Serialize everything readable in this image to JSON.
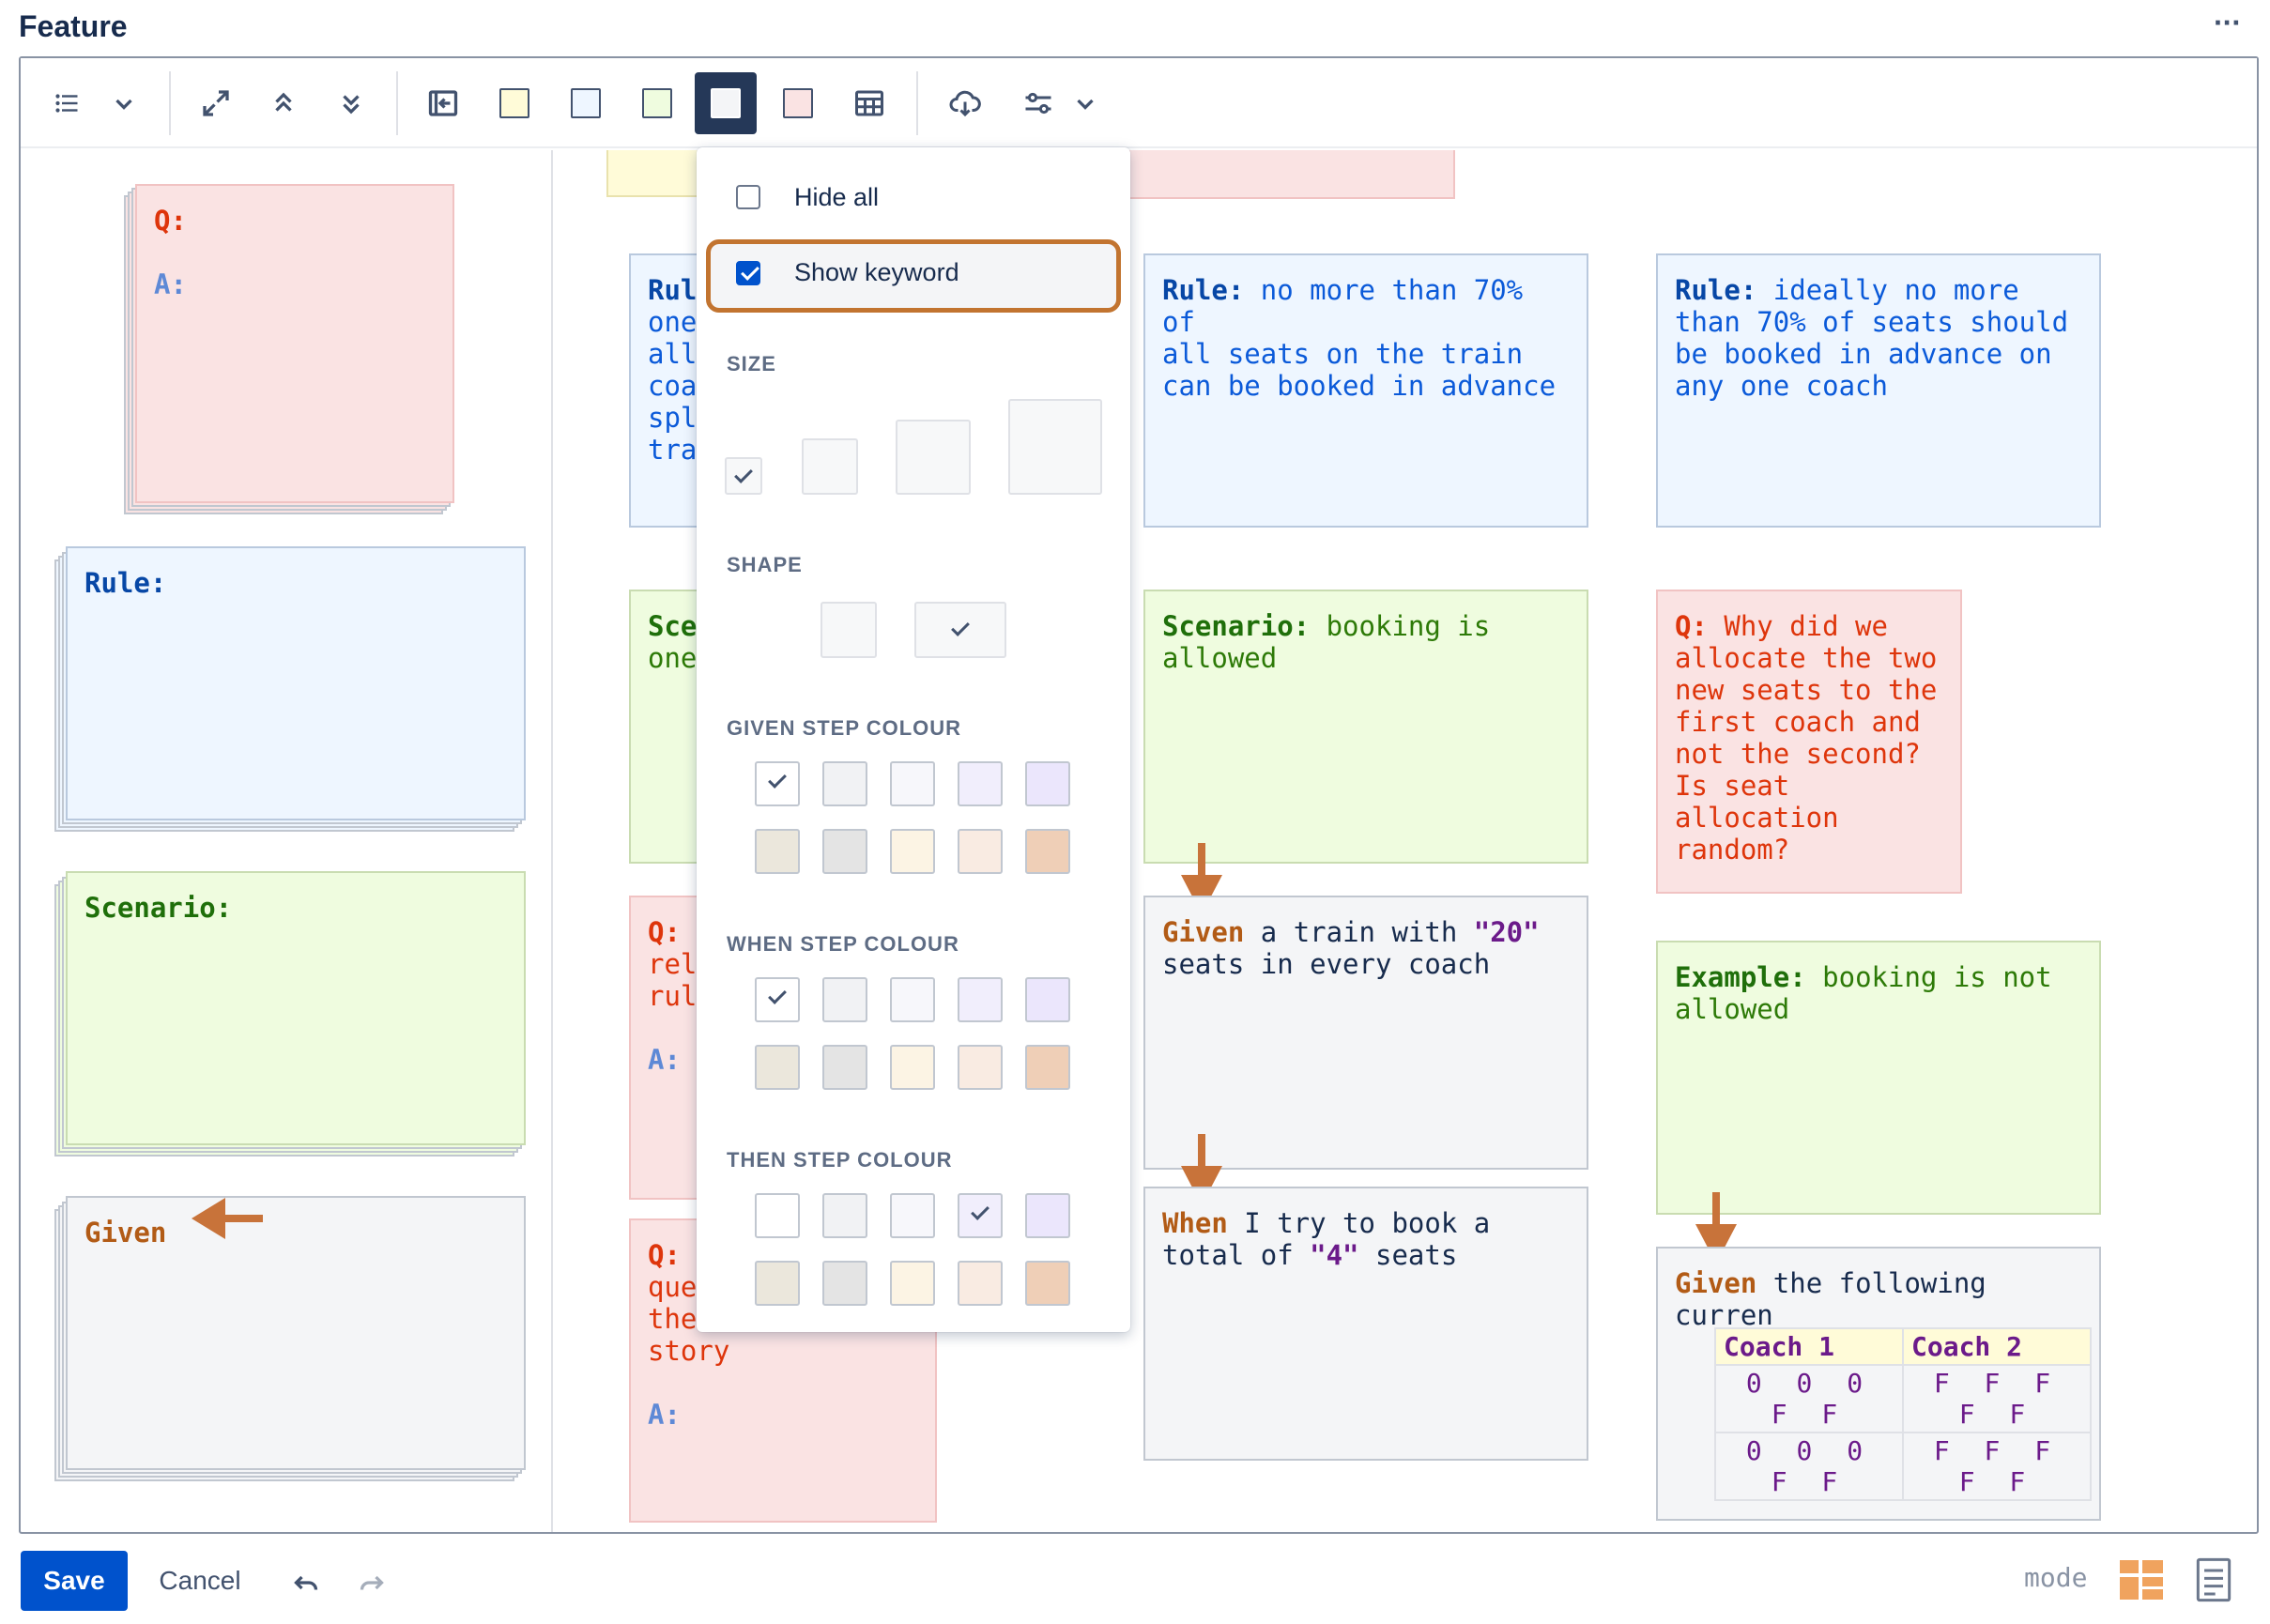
{
  "header": {
    "title": "Feature",
    "more_label": "···"
  },
  "toolbar": {
    "icons": [
      "list-icon",
      "chevron-down-icon",
      "expand-icon",
      "collapse-up-icon",
      "collapse-down-icon",
      "back-arrow-icon",
      "yellow-card-icon",
      "blue-card-icon",
      "green-card-icon",
      "grey-card-icon",
      "pink-card-icon",
      "table-icon",
      "cloud-download-icon",
      "settings-sliders-icon",
      "chevron-down-icon"
    ],
    "swatches": {
      "yellow": "#fffbd8",
      "blue": "#eef6ff",
      "green": "#effcdf",
      "grey": "#f4f5f7",
      "pink": "#fae3e3",
      "active_bg": "#253858"
    }
  },
  "dropdown": {
    "hide_all_label": "Hide all",
    "hide_all_checked": false,
    "show_keyword_label": "Show keyword",
    "show_keyword_checked": true,
    "size_heading": "SIZE",
    "shape_heading": "SHAPE",
    "given_heading": "GIVEN STEP COLOUR",
    "when_heading": "WHEN STEP COLOUR",
    "then_heading": "THEN STEP COLOUR",
    "colour_rows": [
      [
        "#ffffff",
        "#f1f2f4",
        "#f7f7fb",
        "#f1eefc",
        "#ebe6fc"
      ],
      [
        "#ebe7dc",
        "#e4e4e4",
        "#fcf4e4",
        "#f9ebe2",
        "#efcfb7"
      ]
    ]
  },
  "left_column": {
    "qa_card": {
      "q": "Q:",
      "a": "A:"
    },
    "rule_card": {
      "keyword": "Rule:"
    },
    "scenario_card": {
      "keyword": "Scenario:"
    },
    "given_card": {
      "keyword": "Given"
    }
  },
  "board": {
    "rule_partial": {
      "lines": [
        "Rul",
        "one",
        "all",
        "coa",
        "spl",
        "tra"
      ]
    },
    "scenario_partial": {
      "lines": [
        "Sce",
        "one"
      ]
    },
    "q_partial_1": {
      "q": "Q:",
      "lines": [
        "rel",
        "rul"
      ],
      "a": "A:"
    },
    "q_partial_2": {
      "q": "Q:",
      "lines": [
        "que",
        "the",
        "story"
      ],
      "a": "A:"
    },
    "rule_1": {
      "keyword": "Rule:",
      "text": " no more than 70% of\nall seats on the train\ncan be booked in advance"
    },
    "rule_2": {
      "keyword": "Rule:",
      "text": " ideally no more\nthan 70% of seats should\nbe booked in advance on\nany one coach"
    },
    "scenario_1": {
      "keyword": "Scenario:",
      "text": " booking is\nallowed"
    },
    "question_1": {
      "keyword": "Q:",
      "text": " Why did we\nallocate the two\nnew seats to the\nfirst coach and\nnot the second?\nIs seat\nallocation\nrandom?"
    },
    "given_1": {
      "keyword": "Given",
      "text_a": " a train with ",
      "string": "\"20\"",
      "text_b": "\nseats in every coach"
    },
    "when_1": {
      "keyword": "When",
      "text_a": " I try to book a\ntotal of ",
      "string": "\"4\"",
      "text_b": " seats"
    },
    "example_1": {
      "keyword": "Example:",
      "text": " booking is not\nallowed"
    },
    "given_2": {
      "keyword": "Given",
      "text": " the following curren",
      "table": {
        "headers": [
          "Coach 1",
          "Coach 2"
        ],
        "rows": [
          [
            "0 0 0 F F",
            "F F F F F"
          ],
          [
            "0 0 0 F F",
            "F F F F F"
          ]
        ]
      }
    }
  },
  "footer": {
    "save_label": "Save",
    "cancel_label": "Cancel",
    "mode_label": "mode"
  },
  "colors": {
    "accent": "#0052cc",
    "arrow": "#c8733a",
    "highlight_border": "#c27430"
  }
}
